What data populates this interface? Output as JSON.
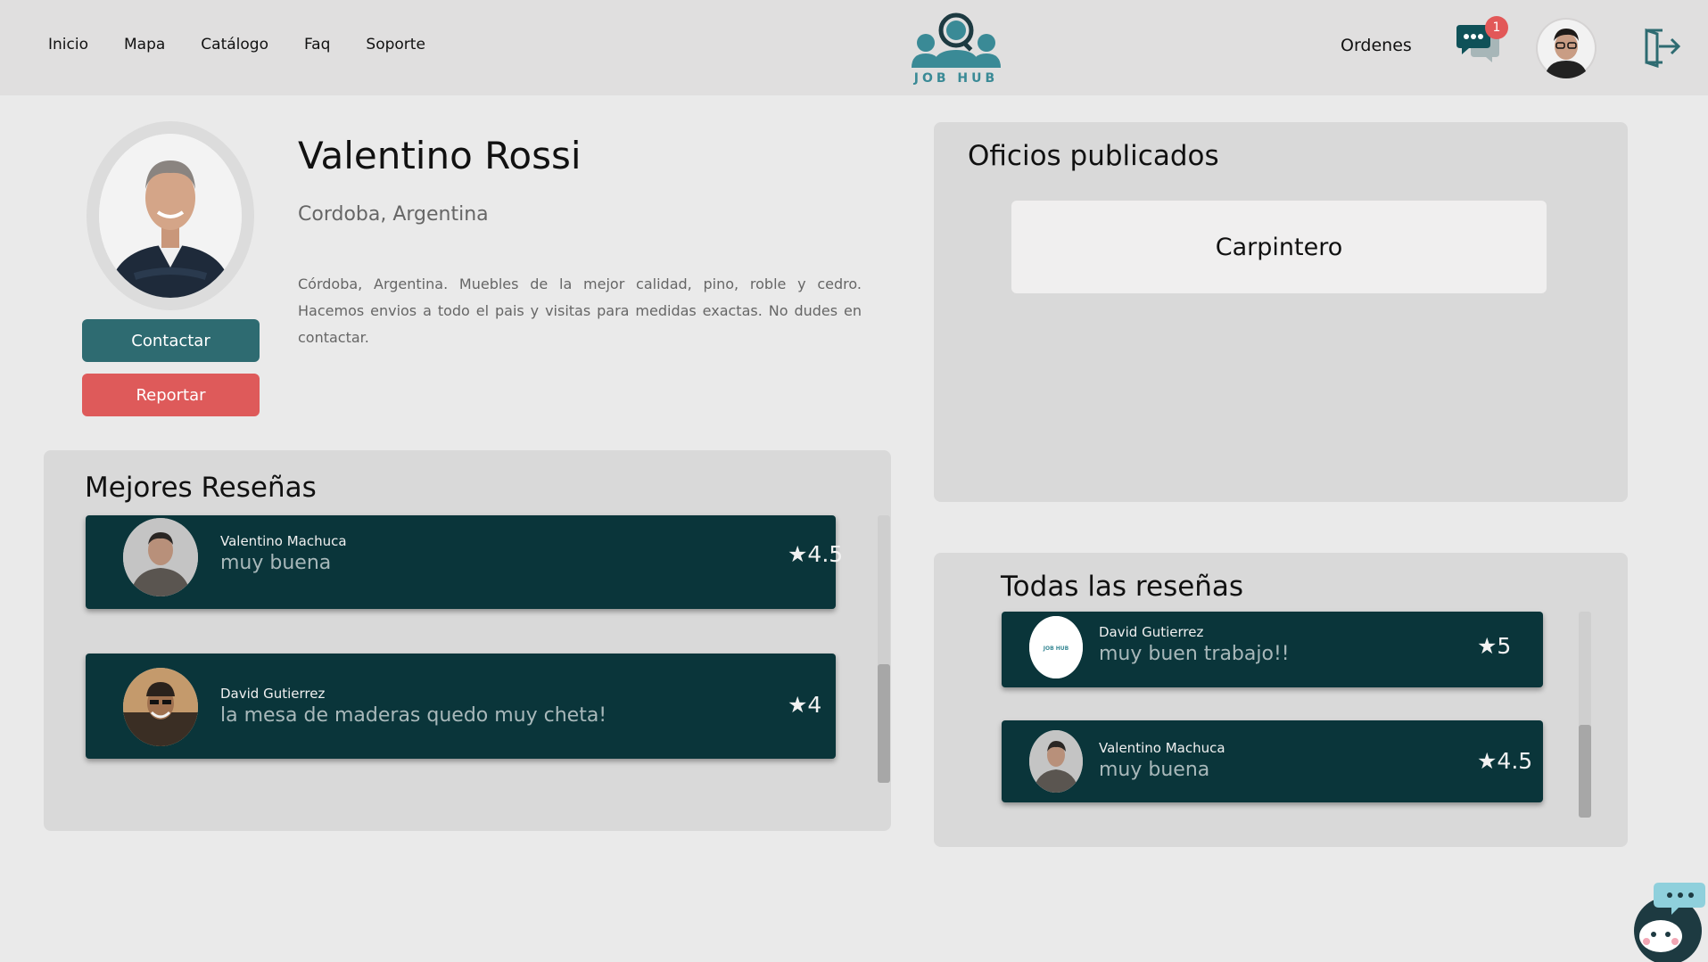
{
  "nav": {
    "items": [
      "Inicio",
      "Mapa",
      "Catálogo",
      "Faq",
      "Soporte"
    ],
    "logo_text": "JOB HUB",
    "orders_label": "Ordenes",
    "chat_badge": "1",
    "chat_icon": "chat-bubbles-icon",
    "logout_icon": "logout-icon"
  },
  "profile": {
    "name": "Valentino Rossi",
    "location": "Cordoba, Argentina",
    "description": "Córdoba, Argentina. Muebles de la mejor calidad, pino, roble y cedro. Hacemos envios a todo el pais y visitas para medidas exactas. No dudes en contactar.",
    "contact_label": "Contactar",
    "report_label": "Reportar"
  },
  "oficios": {
    "title": "Oficios publicados",
    "items": [
      "Carpintero"
    ]
  },
  "best_reviews": {
    "title": "Mejores Reseñas",
    "items": [
      {
        "name": "Valentino Machuca",
        "text": "muy buena",
        "rating": "★4.5"
      },
      {
        "name": "David Gutierrez",
        "text": "la mesa de maderas quedo muy cheta!",
        "rating": "★4"
      }
    ]
  },
  "all_reviews": {
    "title": "Todas las reseñas",
    "items": [
      {
        "name": "David Gutierrez",
        "text": "muy buen trabajo!!",
        "rating": "★5"
      },
      {
        "name": "Valentino Machuca",
        "text": "muy buena",
        "rating": "★4.5"
      }
    ]
  },
  "colors": {
    "primary": "#2e6b71",
    "danger": "#de5a5a",
    "review_bg": "#0a353a",
    "logo": "#3a8a96"
  }
}
